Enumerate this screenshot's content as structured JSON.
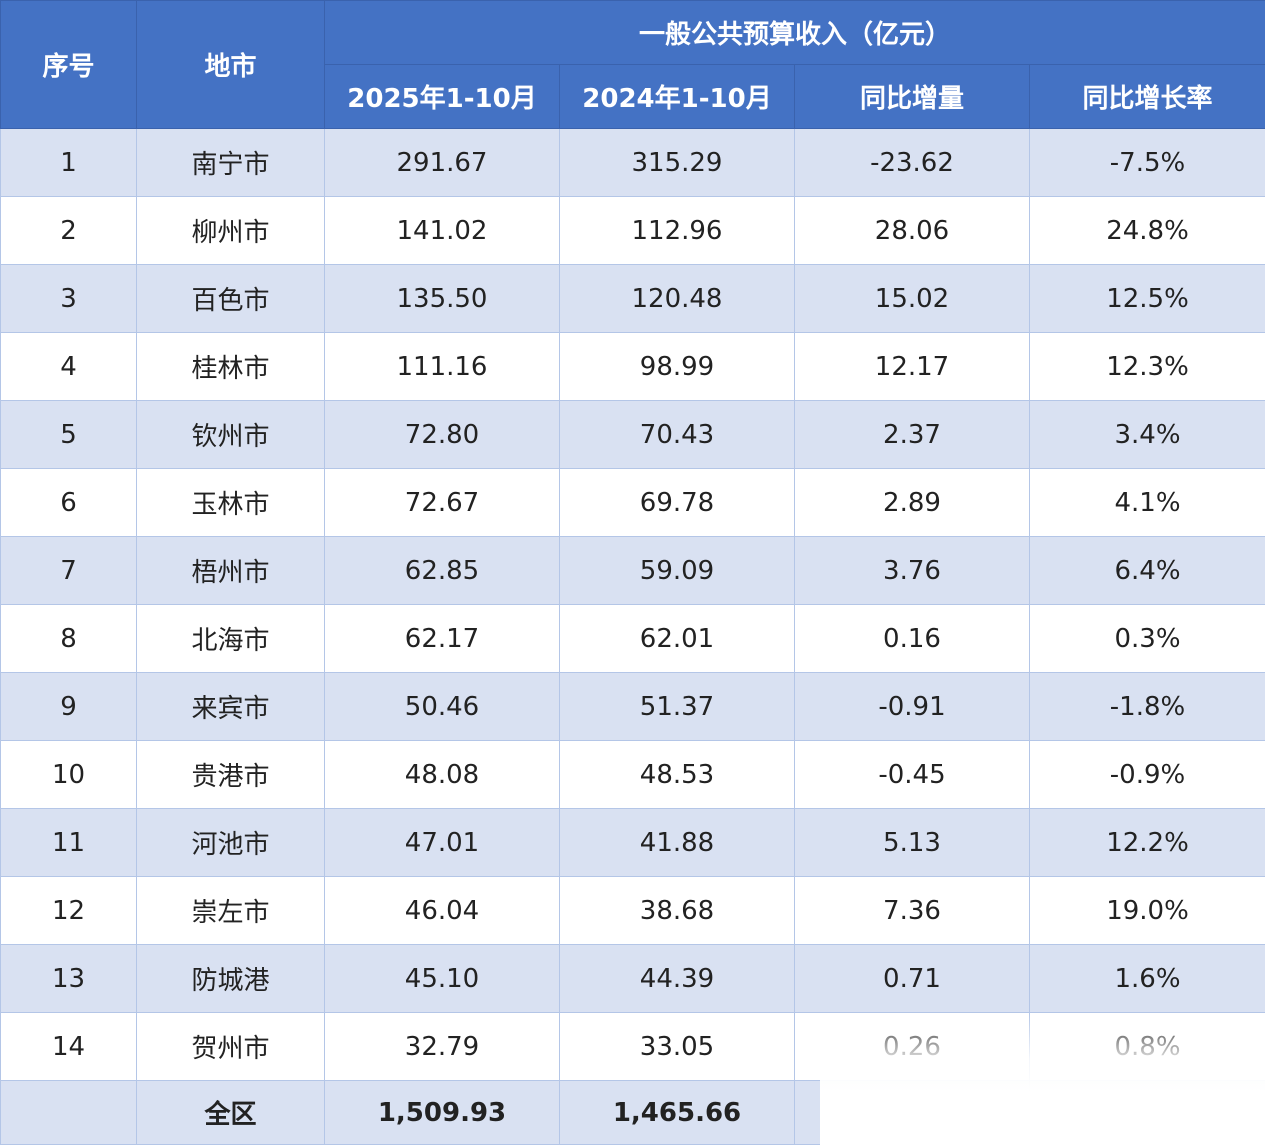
{
  "table": {
    "headers": {
      "index": "序号",
      "city": "地市",
      "group": "一般公共预算收入（亿元）",
      "sub": [
        "2025年1-10月",
        "2024年1-10月",
        "同比增量",
        "同比增长率"
      ]
    },
    "rows": [
      {
        "idx": "1",
        "city": "南宁市",
        "v2025": "291.67",
        "v2024": "315.29",
        "inc": "-23.62",
        "rate": "-7.5%"
      },
      {
        "idx": "2",
        "city": "柳州市",
        "v2025": "141.02",
        "v2024": "112.96",
        "inc": "28.06",
        "rate": "24.8%"
      },
      {
        "idx": "3",
        "city": "百色市",
        "v2025": "135.50",
        "v2024": "120.48",
        "inc": "15.02",
        "rate": "12.5%"
      },
      {
        "idx": "4",
        "city": "桂林市",
        "v2025": "111.16",
        "v2024": "98.99",
        "inc": "12.17",
        "rate": "12.3%"
      },
      {
        "idx": "5",
        "city": "钦州市",
        "v2025": "72.80",
        "v2024": "70.43",
        "inc": "2.37",
        "rate": "3.4%"
      },
      {
        "idx": "6",
        "city": "玉林市",
        "v2025": "72.67",
        "v2024": "69.78",
        "inc": "2.89",
        "rate": "4.1%"
      },
      {
        "idx": "7",
        "city": "梧州市",
        "v2025": "62.85",
        "v2024": "59.09",
        "inc": "3.76",
        "rate": "6.4%"
      },
      {
        "idx": "8",
        "city": "北海市",
        "v2025": "62.17",
        "v2024": "62.01",
        "inc": "0.16",
        "rate": "0.3%"
      },
      {
        "idx": "9",
        "city": "来宾市",
        "v2025": "50.46",
        "v2024": "51.37",
        "inc": "-0.91",
        "rate": "-1.8%"
      },
      {
        "idx": "10",
        "city": "贵港市",
        "v2025": "48.08",
        "v2024": "48.53",
        "inc": "-0.45",
        "rate": "-0.9%"
      },
      {
        "idx": "11",
        "city": "河池市",
        "v2025": "47.01",
        "v2024": "41.88",
        "inc": "5.13",
        "rate": "12.2%"
      },
      {
        "idx": "12",
        "city": "崇左市",
        "v2025": "46.04",
        "v2024": "38.68",
        "inc": "7.36",
        "rate": "19.0%"
      },
      {
        "idx": "13",
        "city": "防城港",
        "v2025": "45.10",
        "v2024": "44.39",
        "inc": "0.71",
        "rate": "1.6%"
      },
      {
        "idx": "14",
        "city": "贺州市",
        "v2025": "32.79",
        "v2024": "33.05",
        "inc": "0.26",
        "rate": "0.8%"
      }
    ],
    "total": {
      "label": "全区",
      "v2025": "1,509.93",
      "v2024": "1,465.66"
    }
  },
  "colors": {
    "header_bg": "#4472c4",
    "header_text": "#ffffff",
    "band_row": "#d9e1f2",
    "plain_row": "#ffffff",
    "grid_line": "#b4c6e7"
  }
}
